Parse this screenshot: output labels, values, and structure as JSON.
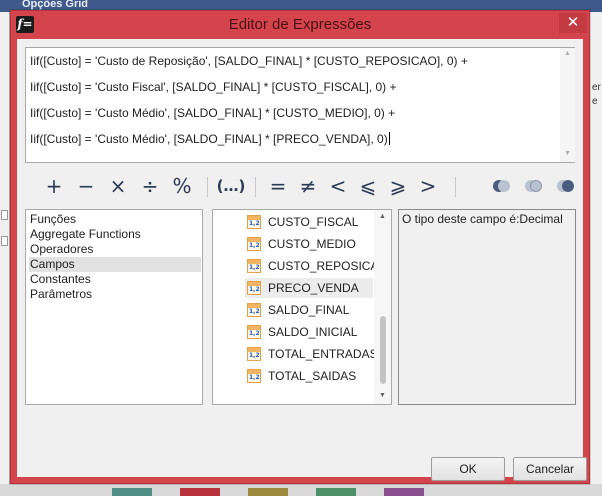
{
  "background": {
    "top_label": "Opções Grid",
    "right_fragments": [
      "er",
      "e"
    ]
  },
  "dialog": {
    "icon_glyph": "f=",
    "title": "Editor de Expressões",
    "close_glyph": "✕"
  },
  "expression": {
    "lines": [
      "Iif([Custo] = 'Custo de Reposição', [SALDO_FINAL] * [CUSTO_REPOSICAO], 0) +",
      "Iif([Custo] = 'Custo Fiscal', [SALDO_FINAL] * [CUSTO_FISCAL], 0) +",
      "Iif([Custo] = 'Custo Médio', [SALDO_FINAL] * [CUSTO_MEDIO], 0) +",
      "Iif([Custo] = 'Custo Médio', [SALDO_FINAL] * [PRECO_VENDA], 0)"
    ]
  },
  "operators": {
    "plus": "+",
    "minus": "−",
    "multiply": "×",
    "divide": "÷",
    "modulo": "%",
    "parens": "(…)",
    "equal": "=",
    "not_equal": "≠",
    "less": "<",
    "less_equal": "⩽",
    "greater_equal": "⩾",
    "greater": ">",
    "logic_icons": [
      "and-icon",
      "or-icon",
      "not-icon"
    ],
    "colors": {
      "operator": "#2b3a55",
      "logic_dark": "#4a5d7e",
      "logic_light": "#b9c2d1"
    }
  },
  "categories": {
    "items": [
      "Funções",
      "Aggregate Functions",
      "Operadores",
      "Campos",
      "Constantes",
      "Parâmetros"
    ],
    "selected": "Campos"
  },
  "fields": {
    "icon_label": "1,2",
    "items": [
      "CUSTO_FISCAL",
      "CUSTO_MEDIO",
      "CUSTO_REPOSICAO",
      "PRECO_VENDA",
      "SALDO_FINAL",
      "SALDO_INICIAL",
      "TOTAL_ENTRADAS",
      "TOTAL_SAIDAS"
    ],
    "selected": "PRECO_VENDA"
  },
  "description": {
    "text": "O tipo deste campo é:Decimal"
  },
  "buttons": {
    "ok": "OK",
    "cancel": "Cancelar"
  },
  "colors": {
    "titlebar": "#d4444c",
    "client": "#f0f0f0"
  }
}
